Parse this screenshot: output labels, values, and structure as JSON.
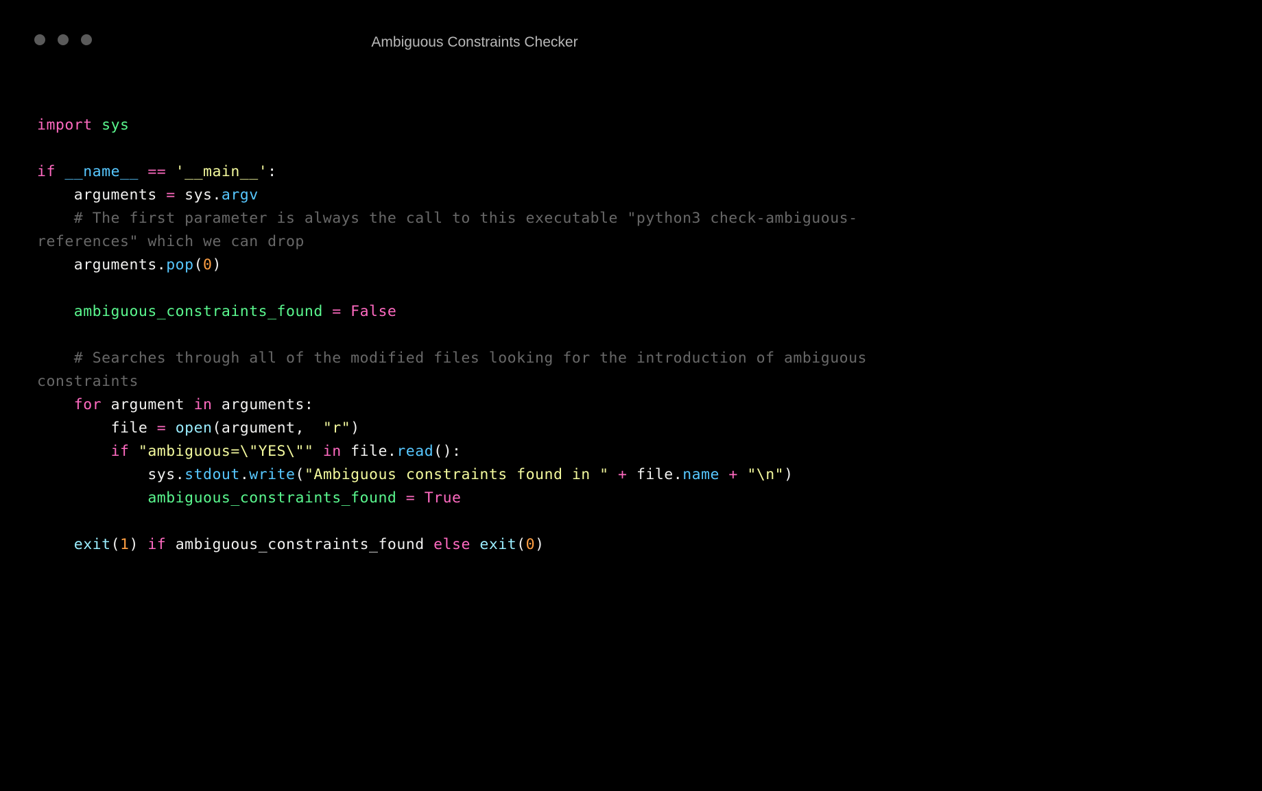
{
  "window": {
    "title": "Ambiguous Constraints Checker"
  },
  "code": {
    "l1_import": "import",
    "l1_sys": "sys",
    "l3_if": "if",
    "l3_name": "__name__",
    "l3_eq": "==",
    "l3_main": "'__main__'",
    "l3_colon": ":",
    "l4_indent": "    ",
    "l4_arguments": "arguments",
    "l4_assign": " = ",
    "l4_sys": "sys",
    "l4_dot": ".",
    "l4_argv": "argv",
    "l5_indent": "    ",
    "l5_comment": "# The first parameter is always the call to this executable \"python3 check-ambiguous-references\" which we can drop",
    "l6_indent": "    ",
    "l6_arguments": "arguments",
    "l6_dot": ".",
    "l6_pop": "pop",
    "l6_open": "(",
    "l6_zero": "0",
    "l6_close": ")",
    "l8_indent": "    ",
    "l8_var": "ambiguous_constraints_found",
    "l8_assign": " = ",
    "l8_false": "False",
    "l10_indent": "    ",
    "l10_comment": "# Searches through all of the modified files looking for the introduction of ambiguous constraints",
    "l11_indent": "    ",
    "l11_for": "for",
    "l11_argument": " argument ",
    "l11_in": "in",
    "l11_arguments": " arguments",
    "l11_colon": ":",
    "l12_indent": "        ",
    "l12_file": "file",
    "l12_assign": " = ",
    "l12_open": "open",
    "l12_paren_open": "(",
    "l12_argument": "argument",
    "l12_comma": ",  ",
    "l12_r": "\"r\"",
    "l12_paren_close": ")",
    "l13_indent": "        ",
    "l13_if": "if",
    "l13_str": " \"ambiguous=\\\"YES\\\"\"",
    "l13_in": " in ",
    "l13_file": "file",
    "l13_dot": ".",
    "l13_read": "read",
    "l13_parens": "()",
    "l13_colon": ":",
    "l14_indent": "            ",
    "l14_sys": "sys",
    "l14_dot1": ".",
    "l14_stdout": "stdout",
    "l14_dot2": ".",
    "l14_write": "write",
    "l14_open": "(",
    "l14_str1": "\"Ambiguous constraints found in \"",
    "l14_plus1": " + ",
    "l14_file": "file",
    "l14_dot3": ".",
    "l14_name": "name",
    "l14_plus2": " + ",
    "l14_str2": "\"\\n\"",
    "l14_close": ")",
    "l15_indent": "            ",
    "l15_var": "ambiguous_constraints_found",
    "l15_assign": " = ",
    "l15_true": "True",
    "l17_indent": "    ",
    "l17_exit1": "exit",
    "l17_open1": "(",
    "l17_one": "1",
    "l17_close1": ")",
    "l17_if": " if ",
    "l17_var": "ambiguous_constraints_found",
    "l17_else": " else ",
    "l17_exit2": "exit",
    "l17_open2": "(",
    "l17_zero": "0",
    "l17_close2": ")"
  }
}
